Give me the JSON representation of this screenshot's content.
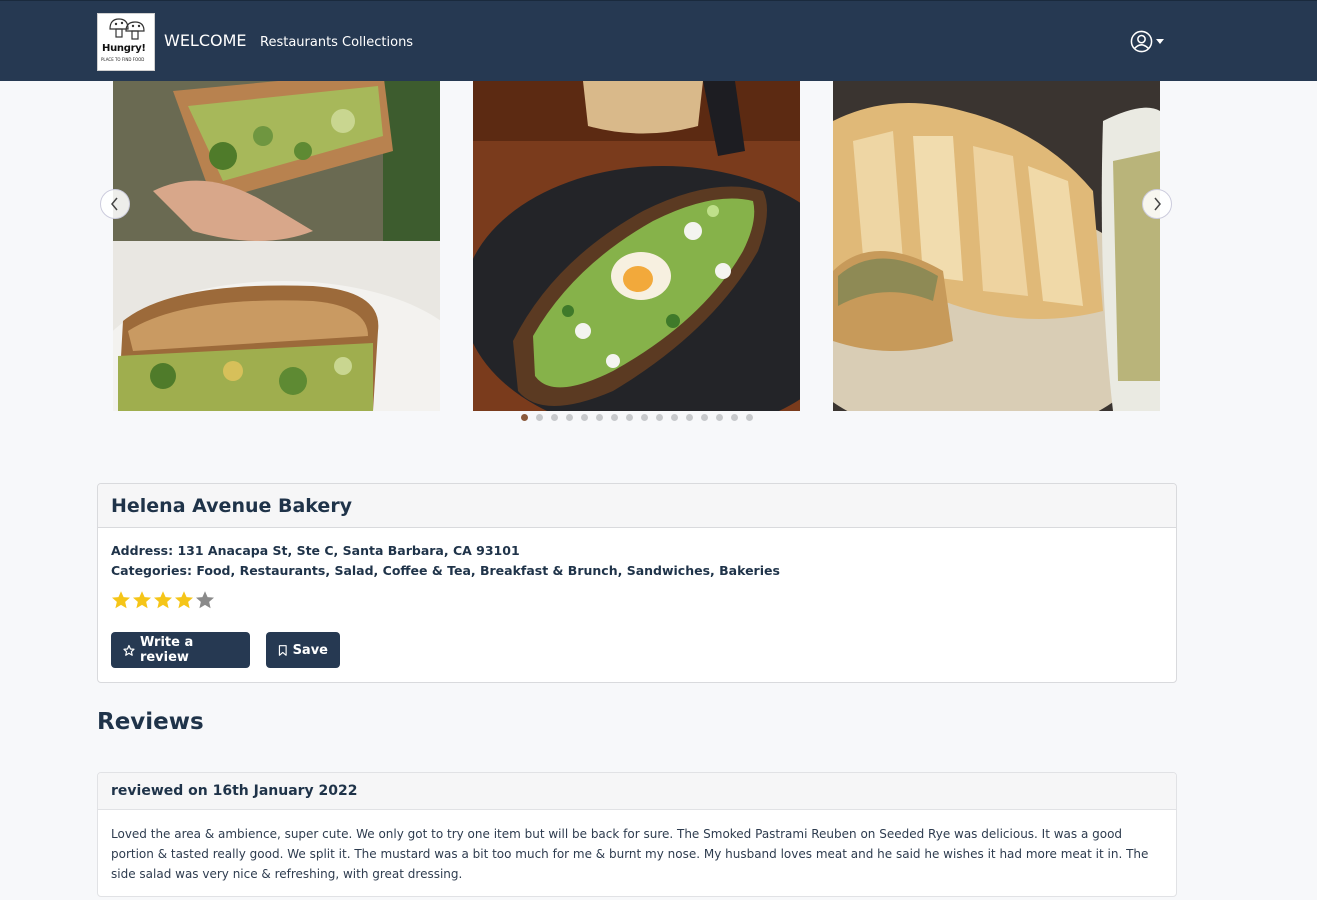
{
  "navbar": {
    "logo_text": "Hungry!",
    "logo_tagline": "PLACE TO FIND FOOD",
    "brand": "WELCOME",
    "links": [
      "Restaurants",
      "Collections"
    ],
    "user_icon": "user-circle-icon"
  },
  "carousel": {
    "slides": [
      "sandwich-photo",
      "avocado-toast-photo",
      "bread-spread-photo"
    ],
    "dot_count": 16,
    "active_dot": 0,
    "prev_icon": "chevron-left-icon",
    "next_icon": "chevron-right-icon"
  },
  "restaurant": {
    "name": "Helena Avenue Bakery",
    "address_label": "Address:",
    "address": "131 Anacapa St, Ste C, Santa Barbara, CA 93101",
    "categories_label": "Categories:",
    "categories": "Food, Restaurants, Salad, Coffee & Tea, Breakfast & Brunch, Sandwiches, Bakeries",
    "rating": 4,
    "rating_max": 5,
    "star_color": "#f5c518",
    "star_empty_color": "#8a8a8a",
    "write_review_label": "Write a review",
    "save_label": "Save"
  },
  "reviews": {
    "heading": "Reviews",
    "items": [
      {
        "date_line": "reviewed on 16th January 2022",
        "text": "Loved the area & ambience, super cute. We only got to try one item but will be back for sure. The Smoked Pastrami Reuben on Seeded Rye was delicious. It was a good portion & tasted really good. We split it. The mustard was a bit too much for me & burnt my nose. My husband loves meat and he said he wishes it had more meat it in. The side salad was very nice & refreshing, with great dressing."
      }
    ]
  },
  "colors": {
    "navbar": "#263952",
    "primary_button": "#263952",
    "page_bg": "#f7f8fa"
  }
}
